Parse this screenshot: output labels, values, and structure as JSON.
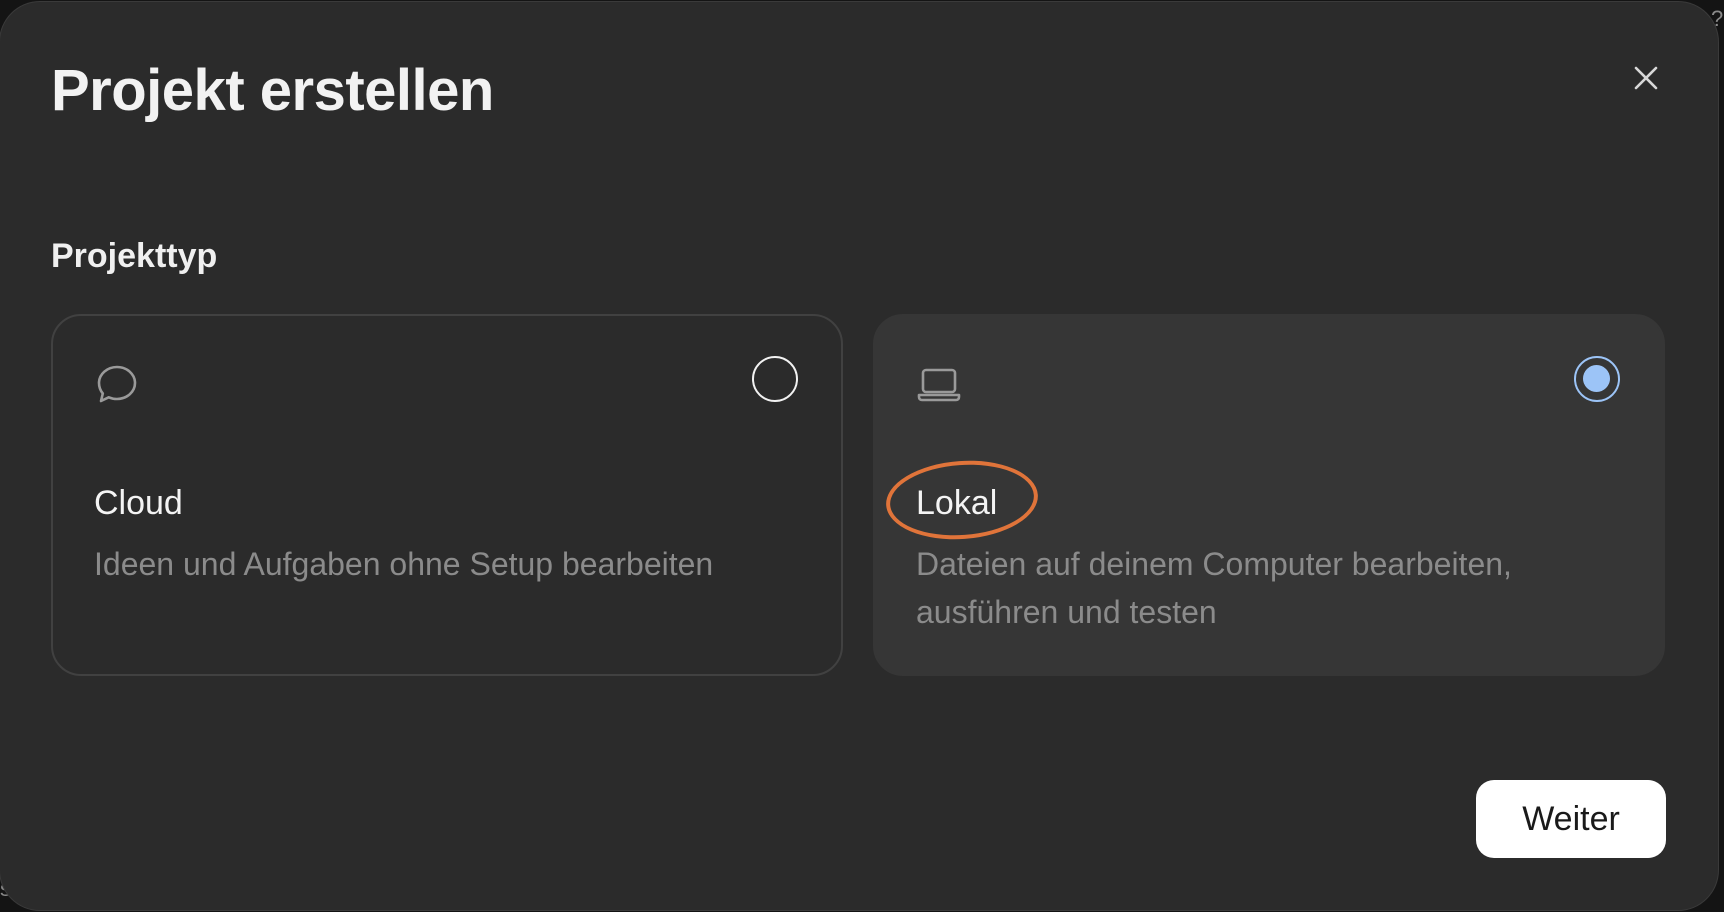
{
  "dialog": {
    "title": "Projekt erstellen",
    "close_icon": "close-icon",
    "section_label": "Projekttyp",
    "options": [
      {
        "icon": "chat-bubble-icon",
        "title": "Cloud",
        "description": "Ideen und Aufgaben ohne Setup bearbeiten",
        "selected": false
      },
      {
        "icon": "laptop-icon",
        "title": "Lokal",
        "description": "Dateien auf deinem Computer bearbeiten, ausführen und testen",
        "selected": true,
        "annotation": "orange-circle-highlight"
      }
    ],
    "next_button_label": "Weiter"
  },
  "colors": {
    "dialog_bg": "#2b2b2b",
    "selected_card_bg": "#363636",
    "radio_selected": "#9cc4f7",
    "highlight": "#e0743a",
    "primary_button_bg": "#ffffff"
  },
  "edge_fragments": {
    "top_right": "?",
    "bottom_left": "s"
  }
}
